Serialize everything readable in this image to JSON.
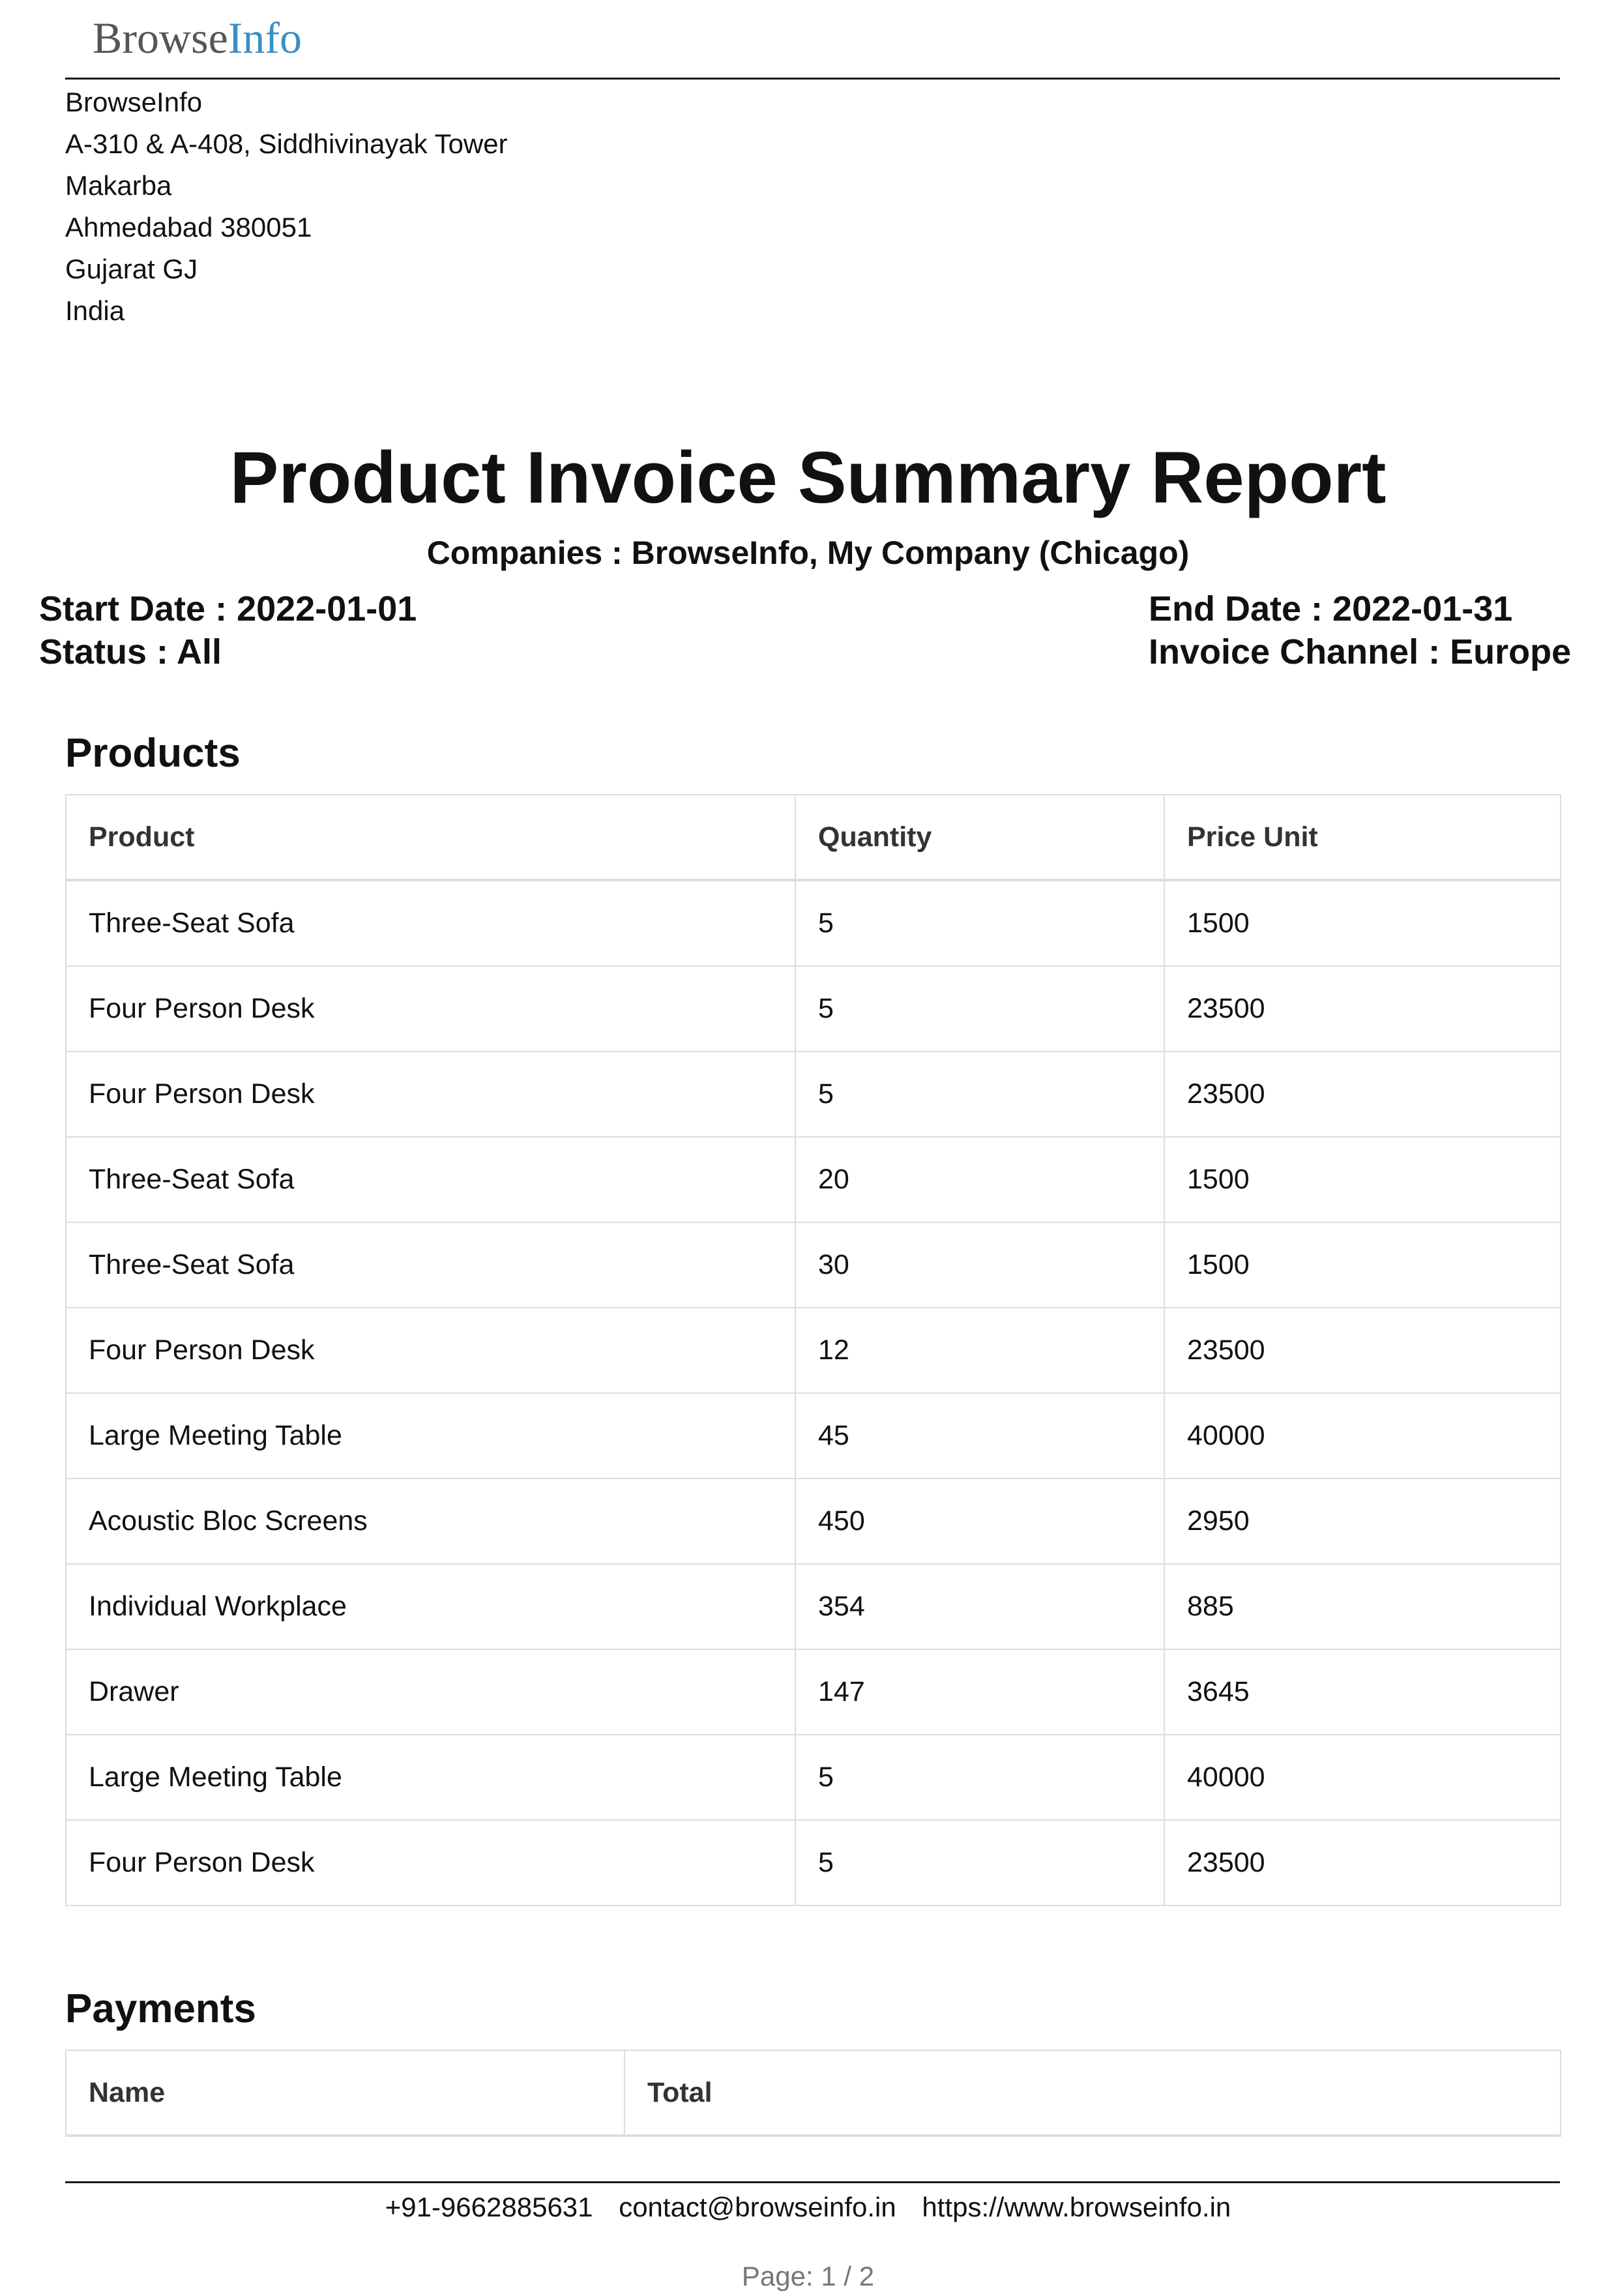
{
  "logo": {
    "part1": "Browse",
    "part2": "Info"
  },
  "company": {
    "name": "BrowseInfo",
    "address_line1": "A-310 & A-408, Siddhivinayak Tower",
    "address_line2": "Makarba",
    "address_line3": "Ahmedabad 380051",
    "address_line4": "Gujarat GJ",
    "address_line5": "India"
  },
  "report": {
    "title": "Product Invoice Summary Report",
    "companies_label": "Companies :",
    "companies_value": "BrowseInfo, My Company (Chicago)",
    "start_date_label": "Start Date :",
    "start_date_value": "2022-01-01",
    "status_label": "Status :",
    "status_value": "All",
    "end_date_label": "End Date :",
    "end_date_value": "2022-01-31",
    "channel_label": "Invoice Channel :",
    "channel_value": "Europe"
  },
  "products": {
    "heading": "Products",
    "columns": [
      "Product",
      "Quantity",
      "Price Unit"
    ],
    "rows": [
      [
        "Three-Seat Sofa",
        "5",
        "1500"
      ],
      [
        "Four Person Desk",
        "5",
        "23500"
      ],
      [
        "Four Person Desk",
        "5",
        "23500"
      ],
      [
        "Three-Seat Sofa",
        "20",
        "1500"
      ],
      [
        "Three-Seat Sofa",
        "30",
        "1500"
      ],
      [
        "Four Person Desk",
        "12",
        "23500"
      ],
      [
        "Large Meeting Table",
        "45",
        "40000"
      ],
      [
        "Acoustic Bloc Screens",
        "450",
        "2950"
      ],
      [
        "Individual Workplace",
        "354",
        "885"
      ],
      [
        "Drawer",
        "147",
        "3645"
      ],
      [
        "Large Meeting Table",
        "5",
        "40000"
      ],
      [
        "Four Person Desk",
        "5",
        "23500"
      ]
    ]
  },
  "payments": {
    "heading": "Payments",
    "columns": [
      "Name",
      "Total"
    ]
  },
  "footer": {
    "phone": "+91-9662885631",
    "email": "contact@browseinfo.in",
    "website": "https://www.browseinfo.in",
    "page": "Page: 1 / 2"
  }
}
